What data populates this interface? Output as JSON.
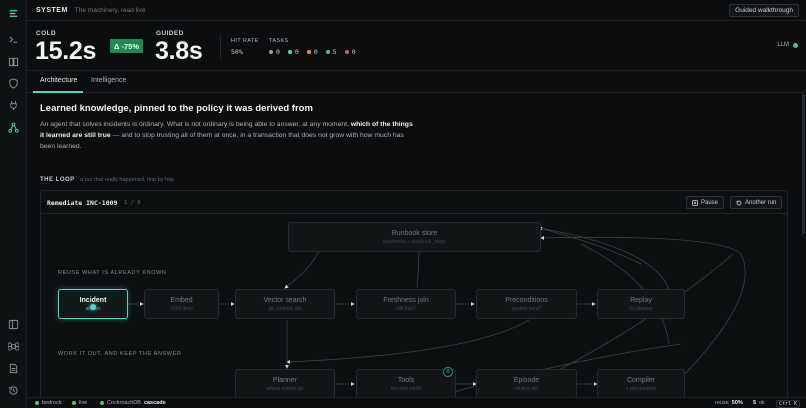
{
  "topbar": {
    "section": "SYSTEM",
    "subtitle": "The machinery, read live",
    "walkthrough": "Guided walkthrough"
  },
  "stats": {
    "cold_label": "COLD",
    "cold_value": "15.2s",
    "delta": "Δ -75%",
    "guided_label": "GUIDED",
    "guided_value": "3.8s",
    "hit_rate_label": "HIT RATE",
    "hit_rate_value": "50%",
    "tasks_label": "TASKS",
    "tasks": [
      {
        "count": "0",
        "color": "#9aa3a7"
      },
      {
        "count": "0",
        "color": "#4fd6c4"
      },
      {
        "count": "0",
        "color": "#e0953f"
      },
      {
        "count": "5",
        "color": "#4cc776"
      },
      {
        "count": "0",
        "color": "#e05a4f"
      }
    ],
    "llm_label": "LLM",
    "llm_color": "#4cc776"
  },
  "tabs": [
    {
      "label": "Architecture"
    },
    {
      "label": "Intelligence"
    }
  ],
  "content": {
    "headline": "Learned knowledge, pinned to the policy it was derived from",
    "para_1": "An agent that solves incidents is ordinary. What is not ordinary is being able to answer, at any moment, ",
    "para_bold": "which of the things it learned are still true",
    "para_2": " — and to stop trusting all of them at once, in a transaction that does not grow with how much has been learned."
  },
  "loop": {
    "label": "THE LOOP",
    "sub": "a run that really happened, hop by hop",
    "title": "Remediate INC-1009",
    "step": "1 / 8",
    "pause": "Pause",
    "another": "Another run"
  },
  "graph": {
    "reuse_label": "REUSE WHAT IS ALREADY KNOWN",
    "work_label": "WORK IT OUT, AND KEEP THE ANSWER",
    "nodes": {
      "runbook": {
        "title": "Runbook store",
        "sub": "playbooks + playbook_steps"
      },
      "incident": {
        "title": "Incident",
        "sub": "arrives"
      },
      "embed": {
        "title": "Embed",
        "sub": "1024 dims"
      },
      "vector": {
        "title": "Vector search",
        "sub": "pb_embed_idx"
      },
      "freshness": {
        "title": "Freshness join",
        "sub": "still true?"
      },
      "precond": {
        "title": "Preconditions",
        "sub": "applies here?"
      },
      "replay": {
        "title": "Replay",
        "sub": "no planner"
      },
      "planner": {
        "title": "Planner",
        "sub": "where tokens go"
      },
      "tools": {
        "title": "Tools",
        "sub": "the real world"
      },
      "episode": {
        "title": "Episode",
        "sub": "what it did"
      },
      "compiler": {
        "title": "Compiler",
        "sub": "+ provenance"
      }
    },
    "tools_badge": "0"
  },
  "status": {
    "bedrock": "bedrock",
    "live": "live",
    "db_label": "CockroachDB",
    "db_value": "cascade",
    "reuse_label": "reuse",
    "reuse_value": "50%",
    "ok_value": "5",
    "ok_label": "ok",
    "shortcut": "Ctrl K"
  },
  "colors": {
    "accent": "#4fd6c4",
    "ok": "#4cc776",
    "delta_bg": "#1f8a52"
  }
}
